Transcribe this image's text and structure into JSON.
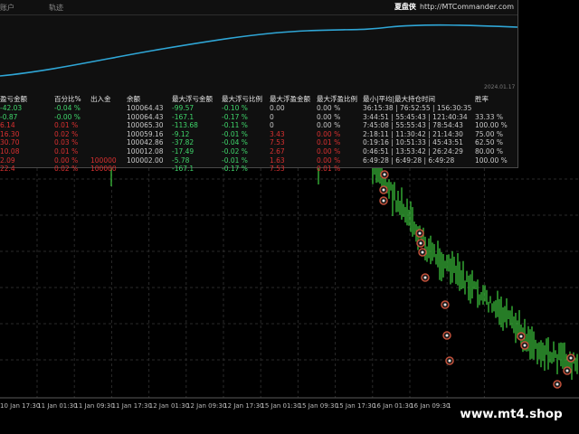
{
  "panel": {
    "tabs": [
      "账户",
      "轨迹"
    ],
    "brand_name": "夏盘侠",
    "brand_url": "http://MTCommander.com",
    "balance_chart_date": "2024.01.17"
  },
  "stats": {
    "headers": [
      "盈亏金额",
      "百分比%",
      "出入金",
      "余额",
      "最大浮亏金额",
      "最大浮亏比例",
      "最大浮盈金额",
      "最大浮盈比例",
      "最小|平均|最大持仓时间",
      "胜率"
    ],
    "rows": [
      {
        "cells": [
          "-42.03",
          "-0.04 %",
          "",
          "100064.43",
          "-99.57",
          "-0.10 %",
          "0.00",
          "0.00 %",
          "36:15:38 | 76:52:55 | 156:30:35",
          ""
        ],
        "colors": [
          "pos",
          "pos",
          "neu",
          "neu",
          "pos",
          "pos",
          "neu",
          "neu",
          "neu",
          "neu"
        ]
      },
      {
        "cells": [
          "-0.87",
          "-0.00 %",
          "",
          "100064.43",
          "-167.1",
          "-0.17 %",
          "0",
          "0.00 %",
          "3:44:51 | 55:45:43 | 121:40:34",
          "33.33 %"
        ],
        "colors": [
          "pos",
          "pos",
          "neu",
          "neu",
          "pos",
          "pos",
          "neu",
          "neu",
          "neu",
          "neu"
        ]
      },
      {
        "cells": [
          "6.14",
          "0.01 %",
          "",
          "100065.30",
          "-113.68",
          "-0.11 %",
          "0",
          "0.00 %",
          "7:45:08 | 55:55:43 | 78:54:43",
          "100.00 %"
        ],
        "colors": [
          "neg",
          "neg",
          "neu",
          "neu",
          "pos",
          "pos",
          "neu",
          "neu",
          "neu",
          "neu"
        ]
      },
      {
        "cells": [
          "16.30",
          "0.02 %",
          "",
          "100059.16",
          "-9.12",
          "-0.01 %",
          "3.43",
          "0.00 %",
          "2:18:11 | 11:30:42 | 21:14:30",
          "75.00 %"
        ],
        "colors": [
          "neg",
          "neg",
          "neu",
          "neu",
          "pos",
          "pos",
          "neg",
          "neg",
          "neu",
          "neu"
        ]
      },
      {
        "cells": [
          "30.70",
          "0.03 %",
          "",
          "100042.86",
          "-37.82",
          "-0.04 %",
          "7.53",
          "0.01 %",
          "0:19:16 | 10:51:33 | 45:43:51",
          "62.50 %"
        ],
        "colors": [
          "neg",
          "neg",
          "neu",
          "neu",
          "pos",
          "pos",
          "neg",
          "neg",
          "neu",
          "neu"
        ]
      },
      {
        "cells": [
          "10.08",
          "0.01 %",
          "",
          "100012.08",
          "-17.49",
          "-0.02 %",
          "2.67",
          "0.00 %",
          "0:46:51 | 13:53:42 | 26:24:29",
          "80.00 %"
        ],
        "colors": [
          "neg",
          "neg",
          "neu",
          "neu",
          "pos",
          "pos",
          "neg",
          "neg",
          "neu",
          "neu"
        ]
      },
      {
        "cells": [
          "2.09",
          "0.00 %",
          "100000",
          "100002.00",
          "-5.78",
          "-0.01 %",
          "1.63",
          "0.00 %",
          "6:49:28 | 6:49:28 | 6:49:28",
          "100.00 %"
        ],
        "colors": [
          "neg",
          "neg",
          "neg",
          "neu",
          "pos",
          "pos",
          "neg",
          "neg",
          "neu",
          "neu"
        ]
      },
      {
        "cells": [
          "22.4",
          "0.02 %",
          "100000",
          "",
          "-167.1",
          "-0.17 %",
          "7.53",
          "0.01 %",
          "",
          ""
        ],
        "colors": [
          "neg",
          "neg",
          "neg",
          "neu",
          "pos",
          "pos",
          "neg",
          "neg",
          "neu",
          "neu"
        ]
      }
    ]
  },
  "axis": {
    "time_labels": [
      "10 Jan 17:30",
      "11 Jan 01:30",
      "11 Jan 09:30",
      "11 Jan 17:30",
      "12 Jan 01:30",
      "12 Jan 09:30",
      "12 Jan 17:30",
      "15 Jan 01:30",
      "15 Jan 09:30",
      "15 Jan 17:30",
      "16 Jan 01:30",
      "16 Jan 09:30",
      "16 Jan 17:30"
    ]
  },
  "watermark": "www.mt4.shop",
  "colors": {
    "background": "#000000",
    "panel_bg": "#101010",
    "balance_line": "#2fa6d6",
    "candle": "#3bbf3b",
    "profit": "#3fd46a",
    "loss": "#d93030",
    "trade_marker": "#c0503a"
  }
}
